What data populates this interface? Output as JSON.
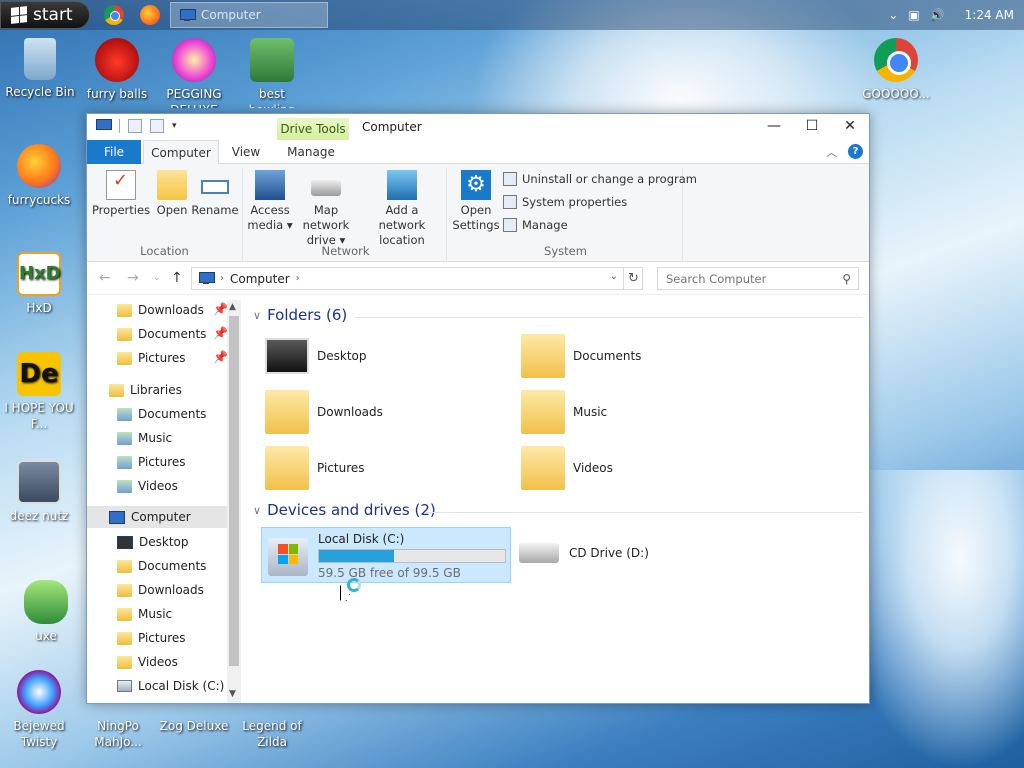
{
  "taskbar": {
    "start_label": "start",
    "task_title": "Computer",
    "clock": "1:24 AM",
    "tray_icons": [
      "chevron-icon",
      "network-icon",
      "volume-icon"
    ]
  },
  "desktop_icons": [
    {
      "label": "Recycle Bin",
      "icon": "recycle-bin-icon"
    },
    {
      "label": "furry balls",
      "icon": "furry-balls-icon"
    },
    {
      "label": "PEGGING DELUXE",
      "icon": "pegging-icon"
    },
    {
      "label": "best bowling",
      "icon": "bowling-icon"
    },
    {
      "label": "GOOOOO...",
      "icon": "chrome-icon"
    },
    {
      "label": "furrycucks",
      "icon": "firefox-icon"
    },
    {
      "label": "HxD",
      "icon": "hxd-icon"
    },
    {
      "label": "I HOPE YOU F...",
      "icon": "de-icon"
    },
    {
      "label": "deez nutz",
      "icon": "windows-stack-icon"
    },
    {
      "label": "uxe",
      "icon": "peridot-icon"
    },
    {
      "label": "Bejewed Twisty",
      "icon": "gem-icon"
    },
    {
      "label": "NingPo MahJo...",
      "icon": "mahjong-icon"
    },
    {
      "label": "Zog Deluxe",
      "icon": "zog-icon"
    },
    {
      "label": "Legend of Zilda",
      "icon": "zilda-icon"
    }
  ],
  "window": {
    "contextual_tab": "Drive Tools",
    "title": "Computer",
    "tabs": [
      "File",
      "Computer",
      "View",
      "Manage"
    ],
    "active_tab": "Computer",
    "ribbon": {
      "location": {
        "label": "Location",
        "buttons": [
          "Properties",
          "Open",
          "Rename"
        ]
      },
      "network": {
        "label": "Network",
        "access_media_1": "Access",
        "access_media_2": "media ▾",
        "map_drive_1": "Map network",
        "map_drive_2": "drive ▾",
        "add_loc_1": "Add a network",
        "add_loc_2": "location"
      },
      "system": {
        "label": "System",
        "open_settings_1": "Open",
        "open_settings_2": "Settings",
        "uninstall": "Uninstall or change a program",
        "sys_props": "System properties",
        "manage": "Manage"
      }
    },
    "address": {
      "path": "Computer",
      "search_placeholder": "Search Computer"
    },
    "nav_pane": {
      "quick_access": [
        "Downloads",
        "Documents",
        "Pictures"
      ],
      "libraries_label": "Libraries",
      "libraries": [
        "Documents",
        "Music",
        "Pictures",
        "Videos"
      ],
      "computer_label": "Computer",
      "computer_items": [
        "Desktop",
        "Documents",
        "Downloads",
        "Music",
        "Pictures",
        "Videos",
        "Local Disk (C:)"
      ]
    },
    "content": {
      "folders_header": "Folders (6)",
      "folders": [
        "Desktop",
        "Documents",
        "Downloads",
        "Music",
        "Pictures",
        "Videos"
      ],
      "devices_header": "Devices and drives (2)",
      "local_disk": {
        "name": "Local Disk (C:)",
        "free_text": "59.5 GB free of 99.5 GB",
        "used_fraction": 0.402
      },
      "cd_drive": "CD Drive (D:)"
    }
  }
}
